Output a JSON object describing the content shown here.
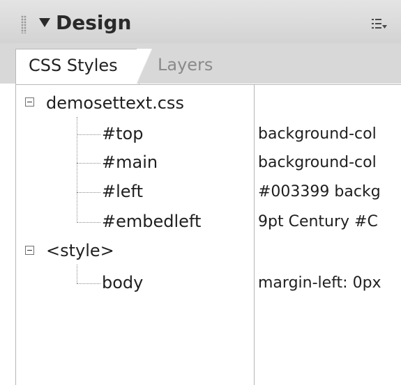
{
  "panel": {
    "title": "Design",
    "collapse_icon": "triangle-down-icon",
    "options_icon": "list-options-icon"
  },
  "tabs": [
    {
      "label": "CSS Styles",
      "active": true
    },
    {
      "label": "Layers",
      "active": false
    }
  ],
  "tree": {
    "groups": [
      {
        "name": "demosettext.css",
        "expanded": true,
        "rules": [
          {
            "selector": "#top",
            "value": "background-col"
          },
          {
            "selector": "#main",
            "value": "background-col"
          },
          {
            "selector": "#left",
            "value": "#003399 backg"
          },
          {
            "selector": "#embedleft",
            "value": "9pt Century #C"
          }
        ]
      },
      {
        "name": "<style>",
        "expanded": true,
        "rules": [
          {
            "selector": "body",
            "value": "margin-left: 0px"
          }
        ]
      }
    ]
  },
  "colors": {
    "titlebar": "#d9d9d9",
    "text": "#1f1f1f",
    "inactive_tab_text": "#8a8a8a"
  }
}
